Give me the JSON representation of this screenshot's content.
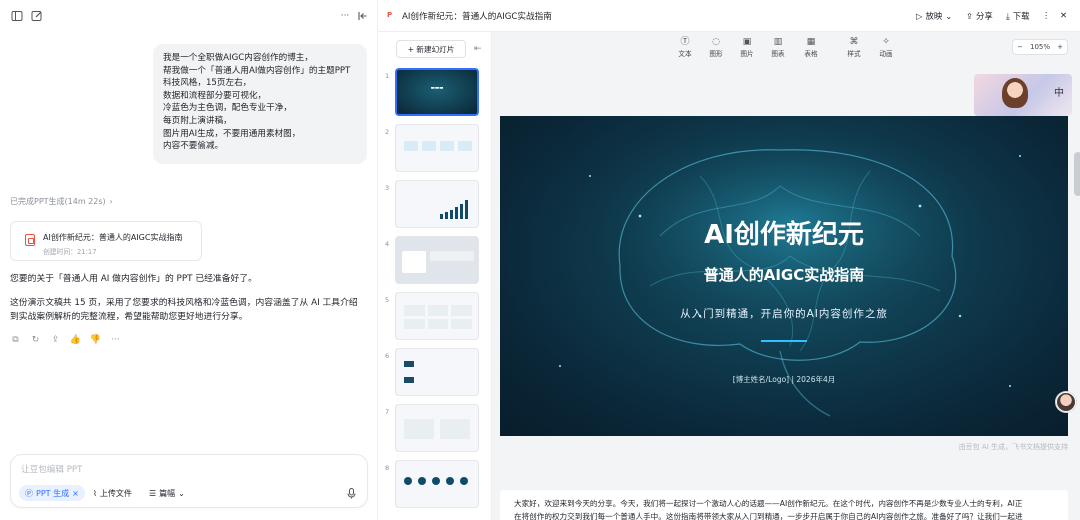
{
  "chat": {
    "user_message_lines": [
      "我是一个全职做AIGC内容创作的博主，",
      "帮我做一个「普通人用AI做内容创作」的主题PPT",
      "科技风格，15页左右，",
      "数据和流程部分要可视化，",
      "冷蓝色为主色调，配色专业干净，",
      "每页附上演讲稿，",
      "图片用AI生成，不要用通用素材图，",
      "内容不要偷减。"
    ],
    "status": "已完成PPT生成(14m 22s)",
    "file_card": {
      "title": "AI创作新纪元：普通人的AIGC实战指南",
      "meta": "创建时间：21:17"
    },
    "reply_para1": "您要的关于「普通人用 AI 做内容创作」的 PPT 已经准备好了。",
    "reply_para2_line1": "这份演示文稿共 15 页，采用了您要求的科技风格和冷蓝色调，内容涵盖了从 AI 工具介绍",
    "reply_para2_line2": "到实战案例解析的完整流程，希望能帮助您更好地进行分享。",
    "composer": {
      "placeholder": "让豆包编辑 PPT",
      "chip_label": "PPT 生成",
      "upload_label": "上传文件",
      "format_label": "篇幅"
    }
  },
  "header": {
    "doc_title": "AI创作新纪元：普通人的AIGC实战指南",
    "play_label": "放映",
    "share_label": "分享",
    "download_label": "下载"
  },
  "thumbs": {
    "new_slide_label": "+ 新建幻灯片",
    "numbers": [
      "1",
      "2",
      "3",
      "4",
      "5",
      "6",
      "7",
      "8"
    ]
  },
  "toolbar": {
    "items": [
      "文本",
      "图形",
      "图片",
      "图表",
      "表格",
      "样式",
      "动画"
    ],
    "zoom": "105%"
  },
  "slide": {
    "title": "AI创作新纪元",
    "subtitle": "普通人的AIGC实战指南",
    "tagline": "从入门到精通，开启你的AI内容创作之旅",
    "footer": "[博主姓名/Logo] | 2026年4月"
  },
  "credit": "由豆包 AI 生成，飞书文档提供支持",
  "notes": {
    "line1": "大家好，欢迎来到今天的分享。今天，我们将一起探讨一个激动人心的话题——AI创作新纪元。在这个时代，内容创作不再是少数专业人士的专利，AI正",
    "line2": "在将创作的权力交到我们每一个普通人手中。这份指南将带领大家从入门到精通，一步步开启属于你自己的AI内容创作之旅。准备好了吗？让我们一起进"
  },
  "colors": {
    "accent": "#3370ff",
    "slide_bg": "#0f3a4d",
    "line_accent": "#2ec3ff"
  }
}
